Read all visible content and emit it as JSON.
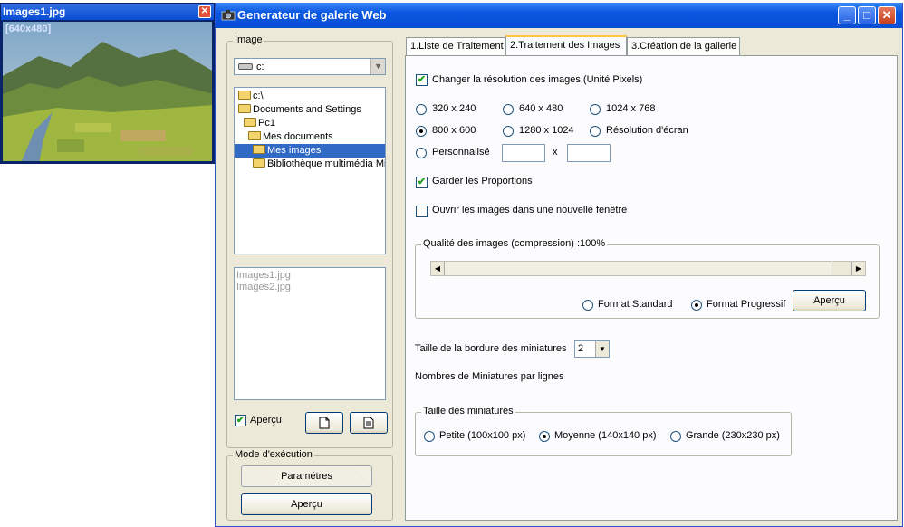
{
  "preview": {
    "title": "Images1.jpg",
    "size_label": "[640x480]",
    "close_label": "✕"
  },
  "window": {
    "title": "Generateur de galerie Web",
    "minimize": "_",
    "maximize": "□",
    "close": "✕"
  },
  "left": {
    "image_legend": "Image",
    "drive": "c:",
    "tree": [
      "c:\\",
      "Documents and Settings",
      "Pc1",
      "Mes documents",
      "Mes images",
      "Bibliothèque multimédia Mic"
    ],
    "files": [
      "Images1.jpg",
      "Images2.jpg"
    ],
    "apercu_check_label": "Aperçu",
    "mode_legend": "Mode d'exécution",
    "parametres_button": "Paramétres",
    "apercu_button": "Aperçu"
  },
  "tabs": [
    "1.Liste de Traitement",
    "2.Traitement des Images",
    "3.Création de la  gallerie"
  ],
  "panel": {
    "change_res_label": "Changer la  résolution des images (Unité Pixels)",
    "resolutions": [
      "320 x 240",
      "640 x 480",
      "1024 x 768",
      "800 x 600",
      "1280 x 1024",
      "Résolution d'écran"
    ],
    "personalise_label": "Personnalisé",
    "times": "x",
    "keep_proportions_label": "Garder les Proportions",
    "open_new_window_label": "Ouvrir les images dans une nouvelle fenêtre",
    "quality_legend": "Qualité des images (compression) :100%",
    "quality_value": 1.0,
    "format_standard": "Format Standard",
    "format_progressive": "Format Progressif",
    "apercu_button": "Aperçu",
    "border_size_label": "Taille de la bordure des miniatures",
    "border_size_value": "2",
    "thumbs_per_line_label": "Nombres de  Miniatures par lignes",
    "thumb_size_legend": "Taille des miniatures",
    "thumb_sizes": [
      "Petite (100x100 px)",
      "Moyenne (140x140 px)",
      "Grande (230x230 px)"
    ]
  }
}
